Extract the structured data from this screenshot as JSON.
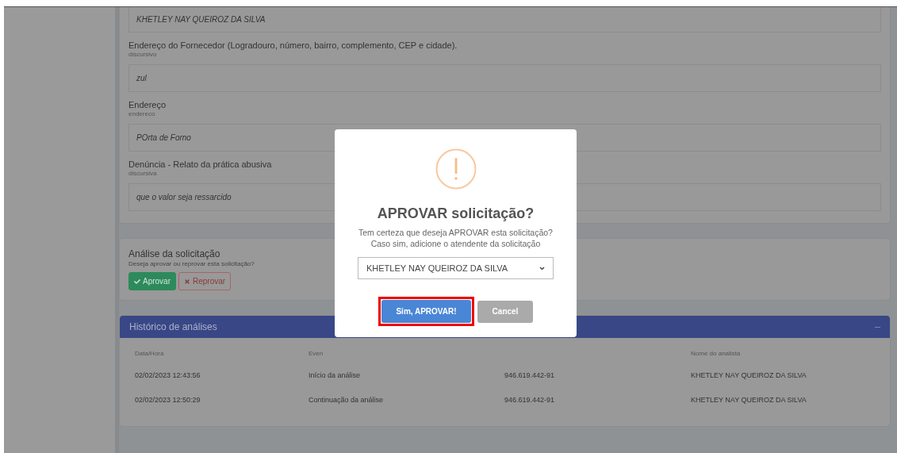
{
  "record": {
    "fields": [
      {
        "value": "KHETLEY NAY QUEIROZ DA SILVA"
      },
      {
        "label": "Endereço do Fornecedor (Logradouro, número, bairro, complemento, CEP e cidade).",
        "hint": "discursivo",
        "value": "zul"
      },
      {
        "label": "Endereço",
        "hint": "endereco",
        "value": "POrta de Forno"
      },
      {
        "label": "Denúncia - Relato da prática abusiva",
        "hint": "discursiva",
        "value": "que o valor seja ressarcido"
      }
    ]
  },
  "analysis": {
    "title": "Análise da solicitação",
    "subtitle": "Deseja aprovar ou reprovar esta solicitação?",
    "buttons": [
      {
        "label": "Aprovar",
        "kind": "approve"
      },
      {
        "label": "Reprovar",
        "kind": "reject"
      }
    ]
  },
  "history": {
    "title": "Histórico de análises",
    "headings": {
      "column_1": "Data/Hora",
      "column_2": "Even",
      "column_4": "Nome do analista"
    },
    "rows": [
      [
        "02/02/2023 12:43:56",
        "Início da análise",
        "946.619.442-91",
        "KHETLEY NAY QUEIROZ DA SILVA"
      ],
      [
        "02/02/2023 12:50:29",
        "Continuação da análise",
        "946.619.442-91",
        "KHETLEY NAY QUEIROZ DA SILVA"
      ]
    ]
  },
  "dialog": {
    "title": "APROVAR solicitação?",
    "message": [
      "Tem certeza que deseja APROVAR esta solicitação?",
      "Caso sim, adicione o atendente da solicitação"
    ],
    "select_value": "KHETLEY NAY QUEIROZ DA SILVA",
    "confirm": {
      "label": "Sim, APROVAR!",
      "focused": true
    },
    "cancel": {
      "label": "Cancel"
    }
  }
}
